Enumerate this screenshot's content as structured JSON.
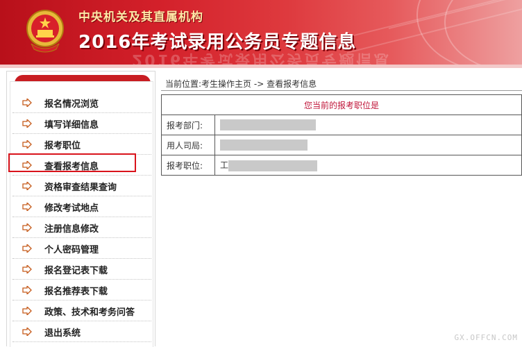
{
  "banner": {
    "subtitle": "中央机关及其直属机构",
    "title": "2016年考试录用公务员专题信息",
    "emblem": "national-emblem",
    "colors": {
      "primary": "#c81d22",
      "title_text": "#ffffff",
      "subtitle_text": "#ffe9a8"
    }
  },
  "sidebar": {
    "item_icon": "arrow-right-icon",
    "items": [
      {
        "label": "报名情况浏览"
      },
      {
        "label": "填写详细信息"
      },
      {
        "label": "报考职位"
      },
      {
        "label": "查看报考信息",
        "highlighted": true
      },
      {
        "label": "资格审查结果查询"
      },
      {
        "label": "修改考试地点"
      },
      {
        "label": "注册信息修改"
      },
      {
        "label": "个人密码管理"
      },
      {
        "label": "报名登记表下载"
      },
      {
        "label": "报名推荐表下载"
      },
      {
        "label": "政策、技术和考务问答"
      },
      {
        "label": "退出系统"
      }
    ]
  },
  "breadcrumb": {
    "prefix": "当前位置:",
    "home": "考生操作主页",
    "separator": "->",
    "current": "查看报考信息"
  },
  "info_table": {
    "header": "您当前的报考职位是",
    "rows": [
      {
        "label": "报考部门:",
        "value": ""
      },
      {
        "label": "用人司局:",
        "value": ""
      },
      {
        "label": "报考职位:",
        "value": "工"
      }
    ],
    "header_color": "#c0163a"
  },
  "watermark": "GX.OFFCN.COM"
}
